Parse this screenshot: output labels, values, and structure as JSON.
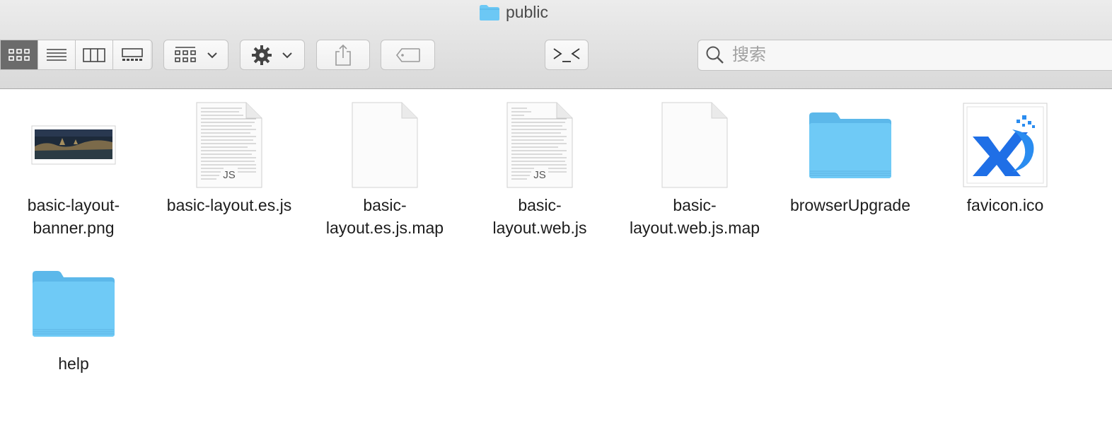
{
  "window": {
    "title": "public"
  },
  "toolbar": {
    "view_buttons": [
      {
        "name": "icon-view",
        "active": true
      },
      {
        "name": "list-view",
        "active": false
      },
      {
        "name": "column-view",
        "active": false
      },
      {
        "name": "gallery-view",
        "active": false
      }
    ],
    "search": {
      "placeholder": "搜索"
    }
  },
  "files": [
    {
      "label": "basic-layout-banner.png",
      "line1": "basic-layout-",
      "line2": "banner.png",
      "type": "image"
    },
    {
      "label": "basic-layout.es.js",
      "line1": "basic-layout.es.js",
      "line2": "",
      "type": "js",
      "badge": "JS"
    },
    {
      "label": "basic-layout.es.js.map",
      "line1": "basic-",
      "line2": "layout.es.js.map",
      "type": "blank"
    },
    {
      "label": "basic-layout.web.js",
      "line1": "basic-",
      "line2": "layout.web.js",
      "type": "js",
      "badge": "JS"
    },
    {
      "label": "basic-layout.web.js.map",
      "line1": "basic-",
      "line2": "layout.web.js.map",
      "type": "blank"
    },
    {
      "label": "browserUpgrade",
      "line1": "browserUpgrade",
      "line2": "",
      "type": "folder"
    },
    {
      "label": "favicon.ico",
      "line1": "favicon.ico",
      "line2": "",
      "type": "ico"
    },
    {
      "label": "help",
      "line1": "help",
      "line2": "",
      "type": "folder"
    }
  ],
  "colors": {
    "folder": "#6cc8f5",
    "folder_dark": "#55b6e8",
    "active_segment": "#6b6b6b",
    "favicon_blue": "#1f6fe6"
  }
}
